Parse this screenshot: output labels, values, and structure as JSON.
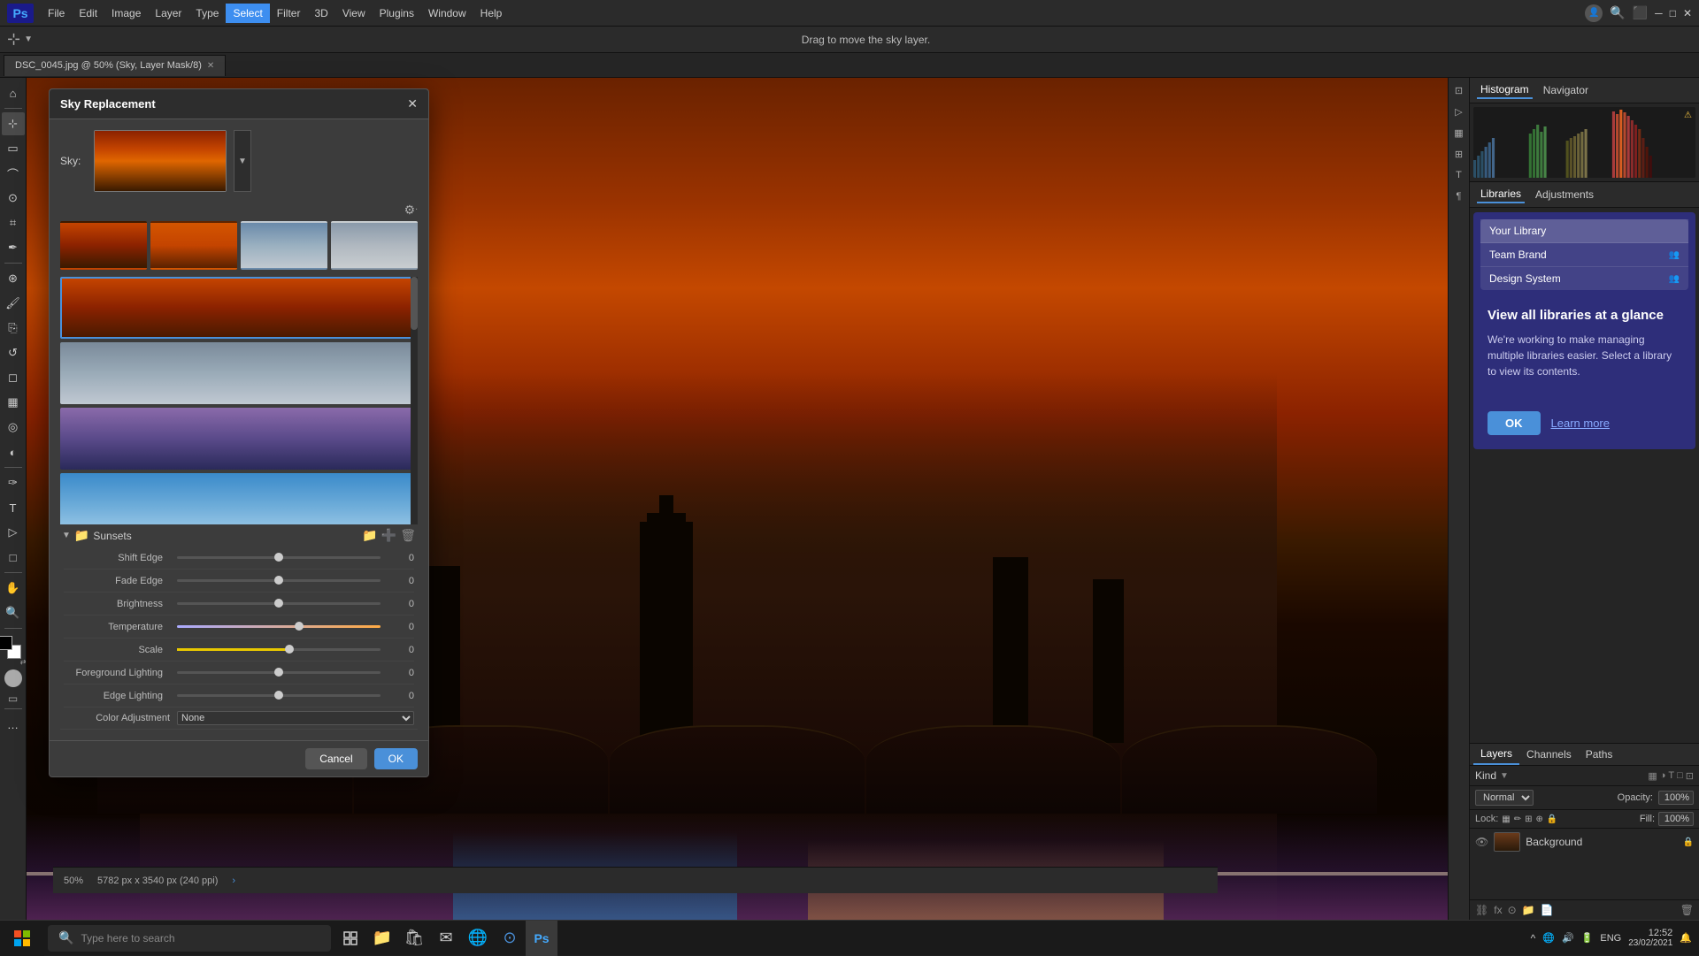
{
  "menubar": {
    "items": [
      "Ps",
      "File",
      "Edit",
      "Image",
      "Layer",
      "Type",
      "Select",
      "Filter",
      "3D",
      "View",
      "Plugins",
      "Window",
      "Help"
    ]
  },
  "options_bar": {
    "hint": "Drag to move the sky layer."
  },
  "doc_tab": {
    "title": "DSC_0045.jpg @ 50% (Sky, Layer Mask/8)"
  },
  "sky_dialog": {
    "title": "Sky Replacement",
    "sky_label": "Sky:",
    "section_label": "Sunsets",
    "cancel_btn": "Cancel",
    "ok_btn": "OK"
  },
  "libraries_panel": {
    "tab_libraries": "Libraries",
    "tab_adjustments": "Adjustments",
    "your_library": "Your Library",
    "team_brand": "Team Brand",
    "design_system": "Design System"
  },
  "library_popup": {
    "title": "View all libraries at a glance",
    "description": "We're working to make managing multiple libraries easier. Select a library to view its contents.",
    "ok_btn": "OK",
    "learn_more": "Learn more"
  },
  "layers_panel": {
    "tab_layers": "Layers",
    "tab_channels": "Channels",
    "tab_paths": "Paths",
    "kind_label": "Kind",
    "blend_mode": "Normal",
    "opacity_label": "Opacity:",
    "opacity_value": "100%",
    "fill_label": "Fill:",
    "fill_value": "100%",
    "lock_label": "Lock:",
    "background_layer": "Background"
  },
  "status_bar": {
    "zoom": "50%",
    "dimensions": "5782 px x 3540 px (240 ppi)"
  },
  "taskbar": {
    "search_placeholder": "Type here to search",
    "time": "12:52",
    "date": "23/02/2021",
    "lang": "ENG"
  },
  "histogram_panel": {
    "tab_histogram": "Histogram",
    "tab_navigator": "Navigator"
  }
}
